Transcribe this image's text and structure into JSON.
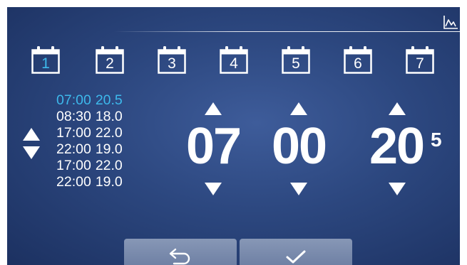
{
  "days": [
    "1",
    "2",
    "3",
    "4",
    "5",
    "6",
    "7"
  ],
  "selected_day": "1",
  "schedule": [
    {
      "time": "07:00",
      "temp": "20.5",
      "active": true
    },
    {
      "time": "08:30",
      "temp": "18.0",
      "active": false
    },
    {
      "time": "17:00",
      "temp": "22.0",
      "active": false
    },
    {
      "time": "22:00",
      "temp": "19.0",
      "active": false
    },
    {
      "time": "17:00",
      "temp": "22.0",
      "active": false
    },
    {
      "time": "22:00",
      "temp": "19.0",
      "active": false
    }
  ],
  "editor": {
    "hours": "07",
    "minutes": "00",
    "temp_whole": "20",
    "temp_decimal": "5"
  },
  "icons": {
    "top_right": "graph-icon",
    "day": "calendar-icon",
    "list_up": "arrow-up-icon",
    "list_down": "arrow-down-icon",
    "back": "back-arrow-icon",
    "confirm": "checkmark-icon"
  },
  "colors": {
    "accent": "#3db9ec",
    "text": "#ffffff",
    "background": "#2c477f",
    "button": "#7a8bad"
  }
}
